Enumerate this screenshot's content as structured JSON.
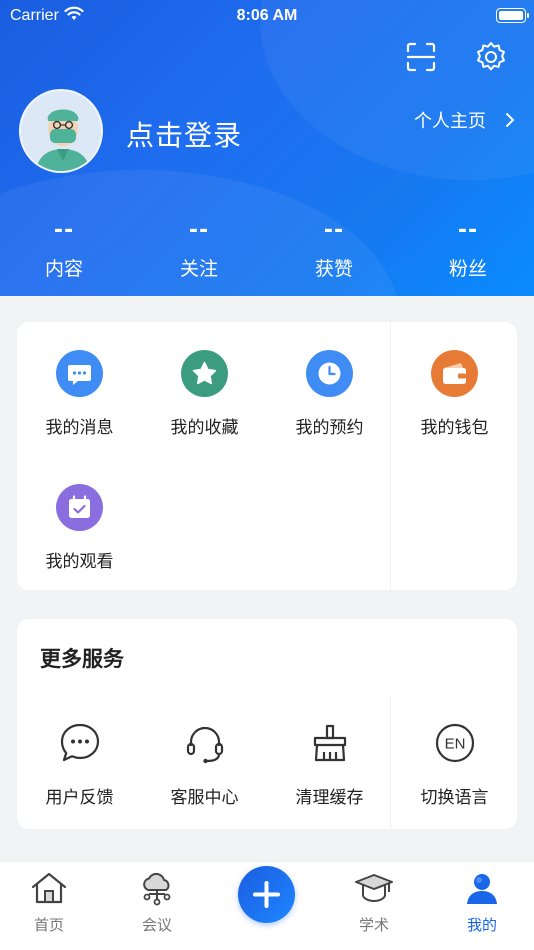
{
  "status_bar": {
    "carrier": "Carrier",
    "time": "8:06 AM"
  },
  "header": {
    "login_text": "点击登录",
    "profile_link": "个人主页",
    "stats": [
      {
        "value": "--",
        "label": "内容"
      },
      {
        "value": "--",
        "label": "关注"
      },
      {
        "value": "--",
        "label": "获赞"
      },
      {
        "value": "--",
        "label": "粉丝"
      }
    ]
  },
  "features": [
    {
      "label": "我的消息",
      "icon": "message-icon",
      "color": "#3f8cf4"
    },
    {
      "label": "我的收藏",
      "icon": "star-icon",
      "color": "#3b9c80"
    },
    {
      "label": "我的预约",
      "icon": "clock-icon",
      "color": "#3f8cf4"
    },
    {
      "label": "我的钱包",
      "icon": "wallet-icon",
      "color": "#e77b35"
    },
    {
      "label": "我的观看",
      "icon": "calendar-check-icon",
      "color": "#8a6ee0"
    }
  ],
  "services": {
    "title": "更多服务",
    "items": [
      {
        "label": "用户反馈",
        "icon": "feedback-icon"
      },
      {
        "label": "客服中心",
        "icon": "headset-icon"
      },
      {
        "label": "清理缓存",
        "icon": "broom-icon"
      },
      {
        "label": "切换语言",
        "icon": "language-icon",
        "badge": "EN"
      }
    ]
  },
  "tabbar": {
    "tabs": [
      {
        "label": "首页",
        "icon": "home-icon"
      },
      {
        "label": "会议",
        "icon": "cloud-network-icon"
      },
      {
        "label": "",
        "icon": "add-icon"
      },
      {
        "label": "学术",
        "icon": "graduation-cap-icon"
      },
      {
        "label": "我的",
        "icon": "user-icon",
        "active": true
      }
    ]
  },
  "colors": {
    "primary": "#1a66e8",
    "background": "#f2f3f5"
  }
}
